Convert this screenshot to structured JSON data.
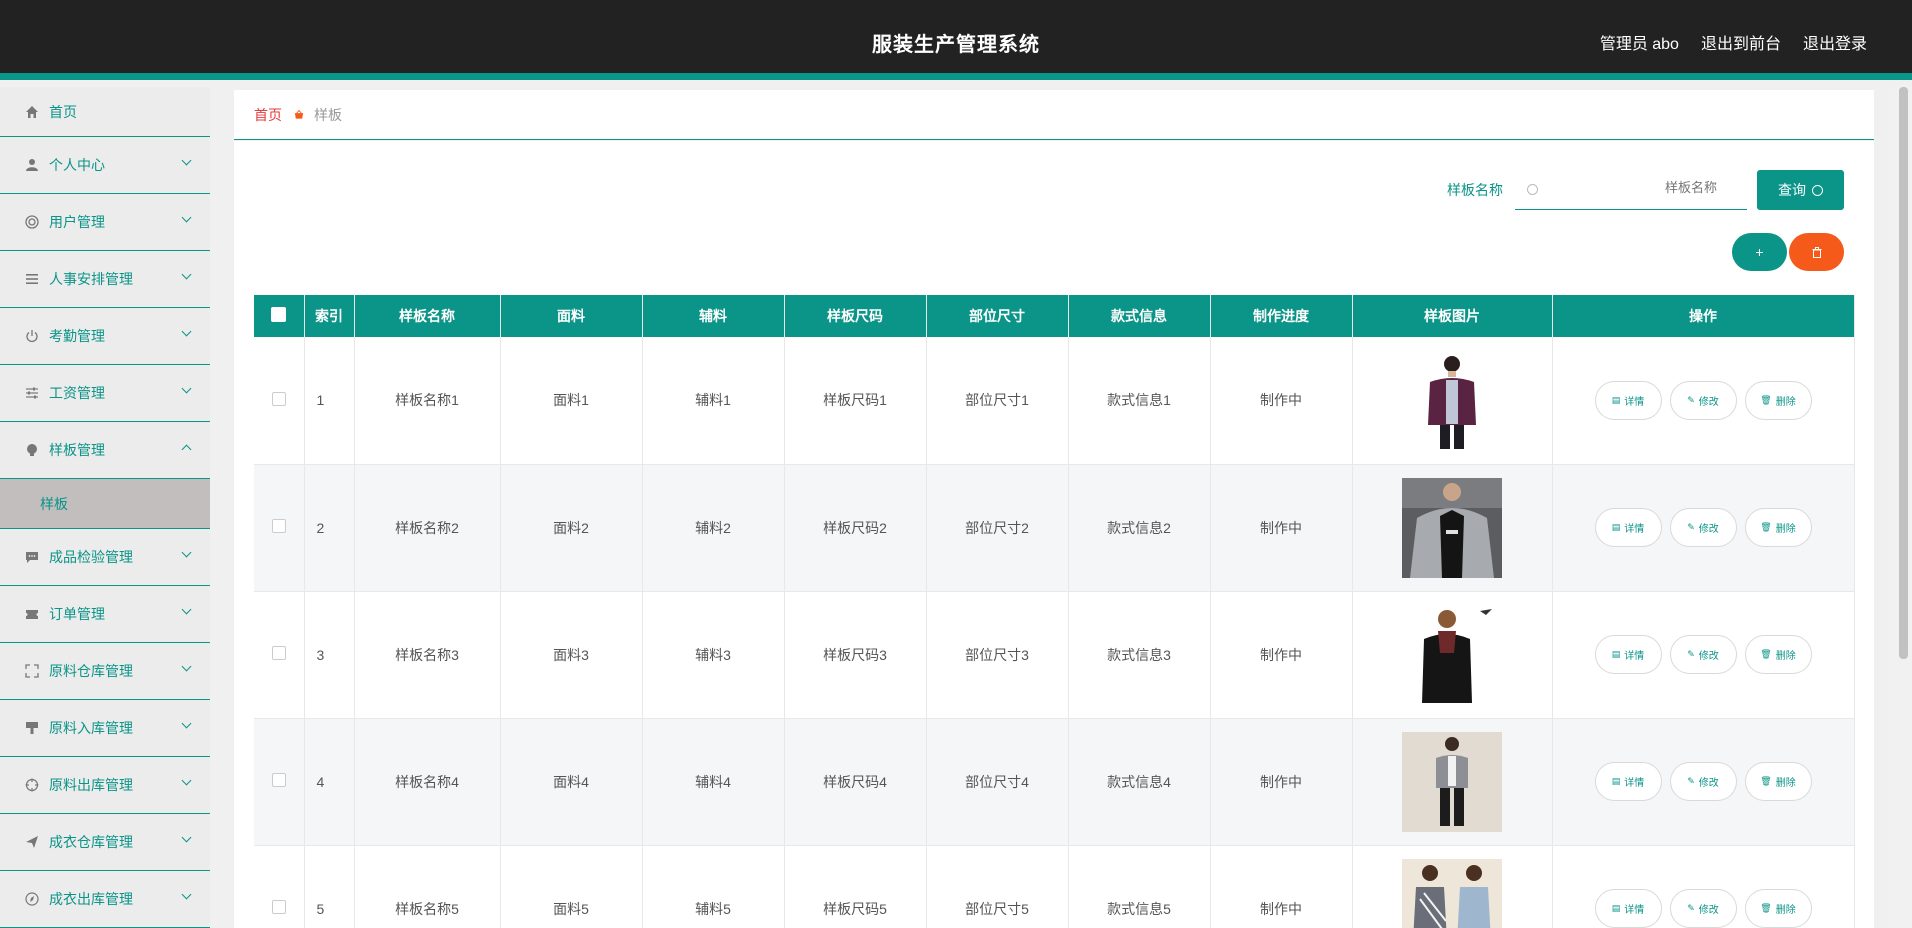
{
  "header": {
    "title": "服装生产管理系统",
    "user": "管理员 abo",
    "to_front": "退出到前台",
    "logout": "退出登录"
  },
  "sidebar": {
    "items": [
      {
        "label": "首页",
        "icon": "home-icon"
      },
      {
        "label": "个人中心",
        "icon": "user-icon"
      },
      {
        "label": "用户管理",
        "icon": "lifebuoy-icon"
      },
      {
        "label": "人事安排管理",
        "icon": "list-icon"
      },
      {
        "label": "考勤管理",
        "icon": "power-icon"
      },
      {
        "label": "工资管理",
        "icon": "sliders-icon"
      },
      {
        "label": "样板管理",
        "icon": "bulb-icon"
      },
      {
        "label": "成品检验管理",
        "icon": "chat-icon"
      },
      {
        "label": "订单管理",
        "icon": "ticket-icon"
      },
      {
        "label": "原料仓库管理",
        "icon": "fullscreen-icon"
      },
      {
        "label": "原料入库管理",
        "icon": "brush-icon"
      },
      {
        "label": "原料出库管理",
        "icon": "crosshair-icon"
      },
      {
        "label": "成衣仓库管理",
        "icon": "send-icon"
      },
      {
        "label": "成衣出库管理",
        "icon": "compass-icon"
      }
    ],
    "sub_active": "样板"
  },
  "breadcrumb": {
    "home": "首页",
    "current": "样板"
  },
  "search": {
    "label": "样板名称",
    "placeholder": "样板名称",
    "button": "查询"
  },
  "toolbar": {
    "add": "+",
    "delete": "🗑"
  },
  "table": {
    "headers": [
      "索引",
      "样板名称",
      "面料",
      "辅料",
      "样板尺码",
      "部位尺寸",
      "款式信息",
      "制作进度",
      "样板图片",
      "操作"
    ],
    "rows": [
      {
        "index": "1",
        "name": "样板名称1",
        "fabric": "面料1",
        "accessory": "辅料1",
        "size": "样板尺码1",
        "part": "部位尺寸1",
        "style": "款式信息1",
        "progress": "制作中"
      },
      {
        "index": "2",
        "name": "样板名称2",
        "fabric": "面料2",
        "accessory": "辅料2",
        "size": "样板尺码2",
        "part": "部位尺寸2",
        "style": "款式信息2",
        "progress": "制作中"
      },
      {
        "index": "3",
        "name": "样板名称3",
        "fabric": "面料3",
        "accessory": "辅料3",
        "size": "样板尺码3",
        "part": "部位尺寸3",
        "style": "款式信息3",
        "progress": "制作中"
      },
      {
        "index": "4",
        "name": "样板名称4",
        "fabric": "面料4",
        "accessory": "辅料4",
        "size": "样板尺码4",
        "part": "部位尺寸4",
        "style": "款式信息4",
        "progress": "制作中"
      },
      {
        "index": "5",
        "name": "样板名称5",
        "fabric": "面料5",
        "accessory": "辅料5",
        "size": "样板尺码5",
        "part": "部位尺寸5",
        "style": "款式信息5",
        "progress": "制作中"
      }
    ],
    "ops": {
      "detail": "详情",
      "edit": "修改",
      "delete": "删除"
    }
  },
  "colors": {
    "accent": "#0b9488",
    "danger": "#f55a1a",
    "header_bg": "#222222"
  }
}
